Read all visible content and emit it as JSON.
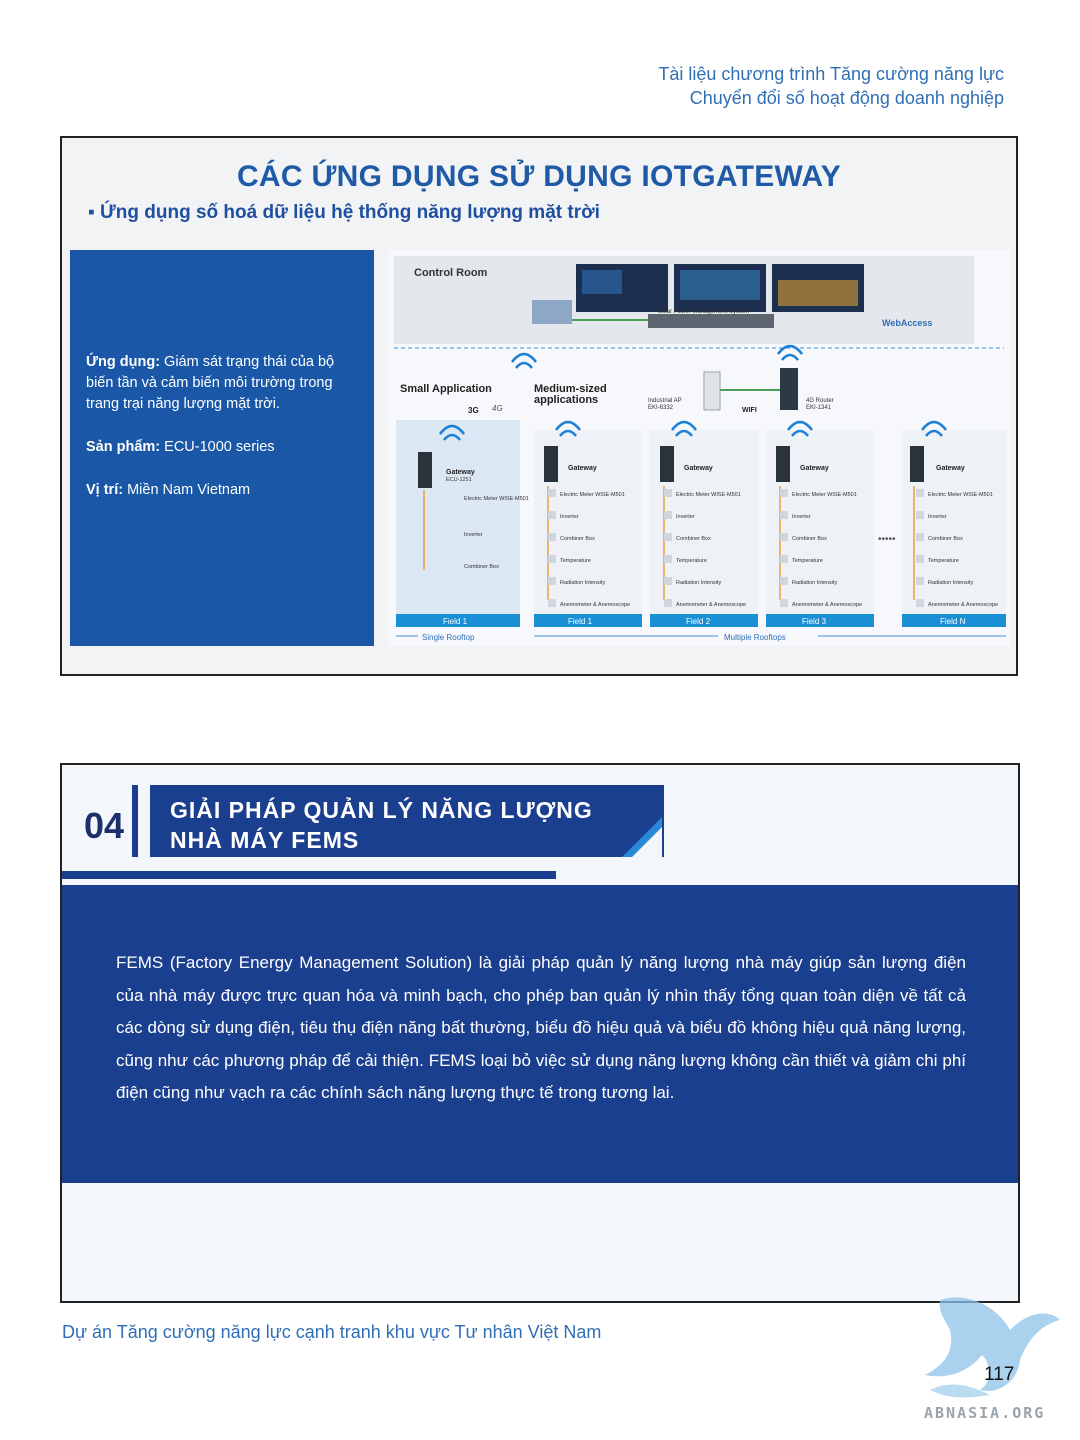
{
  "header": {
    "line1": "Tài liệu chương trình Tăng cường năng lực",
    "line2": "Chuyển đổi số hoạt động doanh nghiệp"
  },
  "slide1": {
    "title": "CÁC ỨNG DỤNG SỬ DỤNG IOTGATEWAY",
    "subtitle": "▪ Ứng dụng số hoá dữ liệu hệ thống năng lượng mặt trời",
    "info": {
      "app_label": "Ứng dụng:",
      "app_value": " Giám sát trạng thái của bộ biến tần và cảm biến môi trường trong trang trại năng lượng mặt trời.",
      "product_label": "Sản phẩm:",
      "product_value": " ECU-1000 series",
      "location_label": "Vị trí:",
      "location_value": " Miền Nam Vietnam"
    },
    "diagram": {
      "control_room": "Control Room",
      "system_label": "Solar Power Management System",
      "webaccess": "WebAccess",
      "small_app": "Small Application",
      "medium_app_1": "Medium-sized",
      "medium_app_2": "applications",
      "net_3g": "3G",
      "net_4g": "4G",
      "ap_1": "Industrial AP",
      "ap_2": "EKI-6332",
      "wifi": "WIFI",
      "router_1": "4G Router",
      "router_2": "EKI-1341",
      "gateway": "Gateway",
      "gateway_model": "ECU-1251",
      "small_items": [
        "Electric Meter WISE-M501",
        "Inverter",
        "Combiner Box"
      ],
      "medium_items": [
        "Electric Meter WISE-M501",
        "Inverter",
        "Combiner Box",
        "Temperature",
        "Radiation Intensity",
        "Anemometer & Anemoscope"
      ],
      "fields": [
        "Field 1",
        "Field 1",
        "Field 2",
        "Field 3",
        "Field N"
      ],
      "single_rooftop": "Single Rooftop",
      "multiple_rooftops": "Multiple Rooftops",
      "dots": "•••••"
    }
  },
  "slide2": {
    "number": "04",
    "title_line1": "GIẢI PHÁP QUẢN LÝ NĂNG LƯỢNG",
    "title_line2": "NHÀ MÁY FEMS",
    "body": "FEMS (Factory Energy Management Solution) là giải pháp quản lý năng lượng nhà máy giúp sản lượng điện của nhà máy được trực quan hóa và minh bạch, cho phép ban quản lý nhìn thấy tổng quan toàn diện về tất cả các dòng sử dụng điện, tiêu thụ điện năng bất thường, biểu đồ hiệu quả và biểu đồ không hiệu quả năng lượng, cũng như các phương pháp để cải thiện. FEMS loại bỏ việc sử dụng năng lượng không cần thiết và giảm chi phí điện cũng như vạch ra các chính sách năng lượng thực tế trong tương lai."
  },
  "footer": {
    "project": "Dự án Tăng cường năng lực cạnh tranh khu vực Tư nhân Việt Nam",
    "page": "117",
    "watermark": "ABNASIA.ORG"
  },
  "colors": {
    "accent_blue": "#1a58a7",
    "dark_blue": "#1b3f8f",
    "text_blue": "#2f6fb5"
  }
}
